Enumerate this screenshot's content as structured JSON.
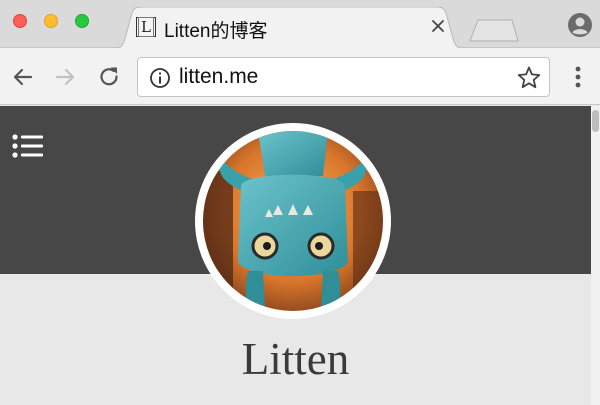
{
  "browser": {
    "window_controls": [
      "close",
      "minimize",
      "zoom"
    ],
    "tab": {
      "title": "Litten的博客",
      "favicon_letter": "L",
      "close_icon": "close-icon"
    },
    "new_tab_icon": "new-tab-icon",
    "profile_icon": "account-circle-icon",
    "toolbar": {
      "back_icon": "arrow-left-icon",
      "forward_icon": "arrow-right-icon",
      "reload_icon": "reload-icon",
      "info_icon": "info-icon",
      "url": "litten.me",
      "bookmark_icon": "star-icon",
      "menu_icon": "more-vert-icon"
    }
  },
  "page": {
    "menu_icon": "list-menu-icon",
    "avatar_alt": "avatar",
    "site_title": "Litten"
  },
  "colors": {
    "banner": "#474747",
    "page_bg": "#e8e8e8",
    "title": "#3a3a3a"
  }
}
